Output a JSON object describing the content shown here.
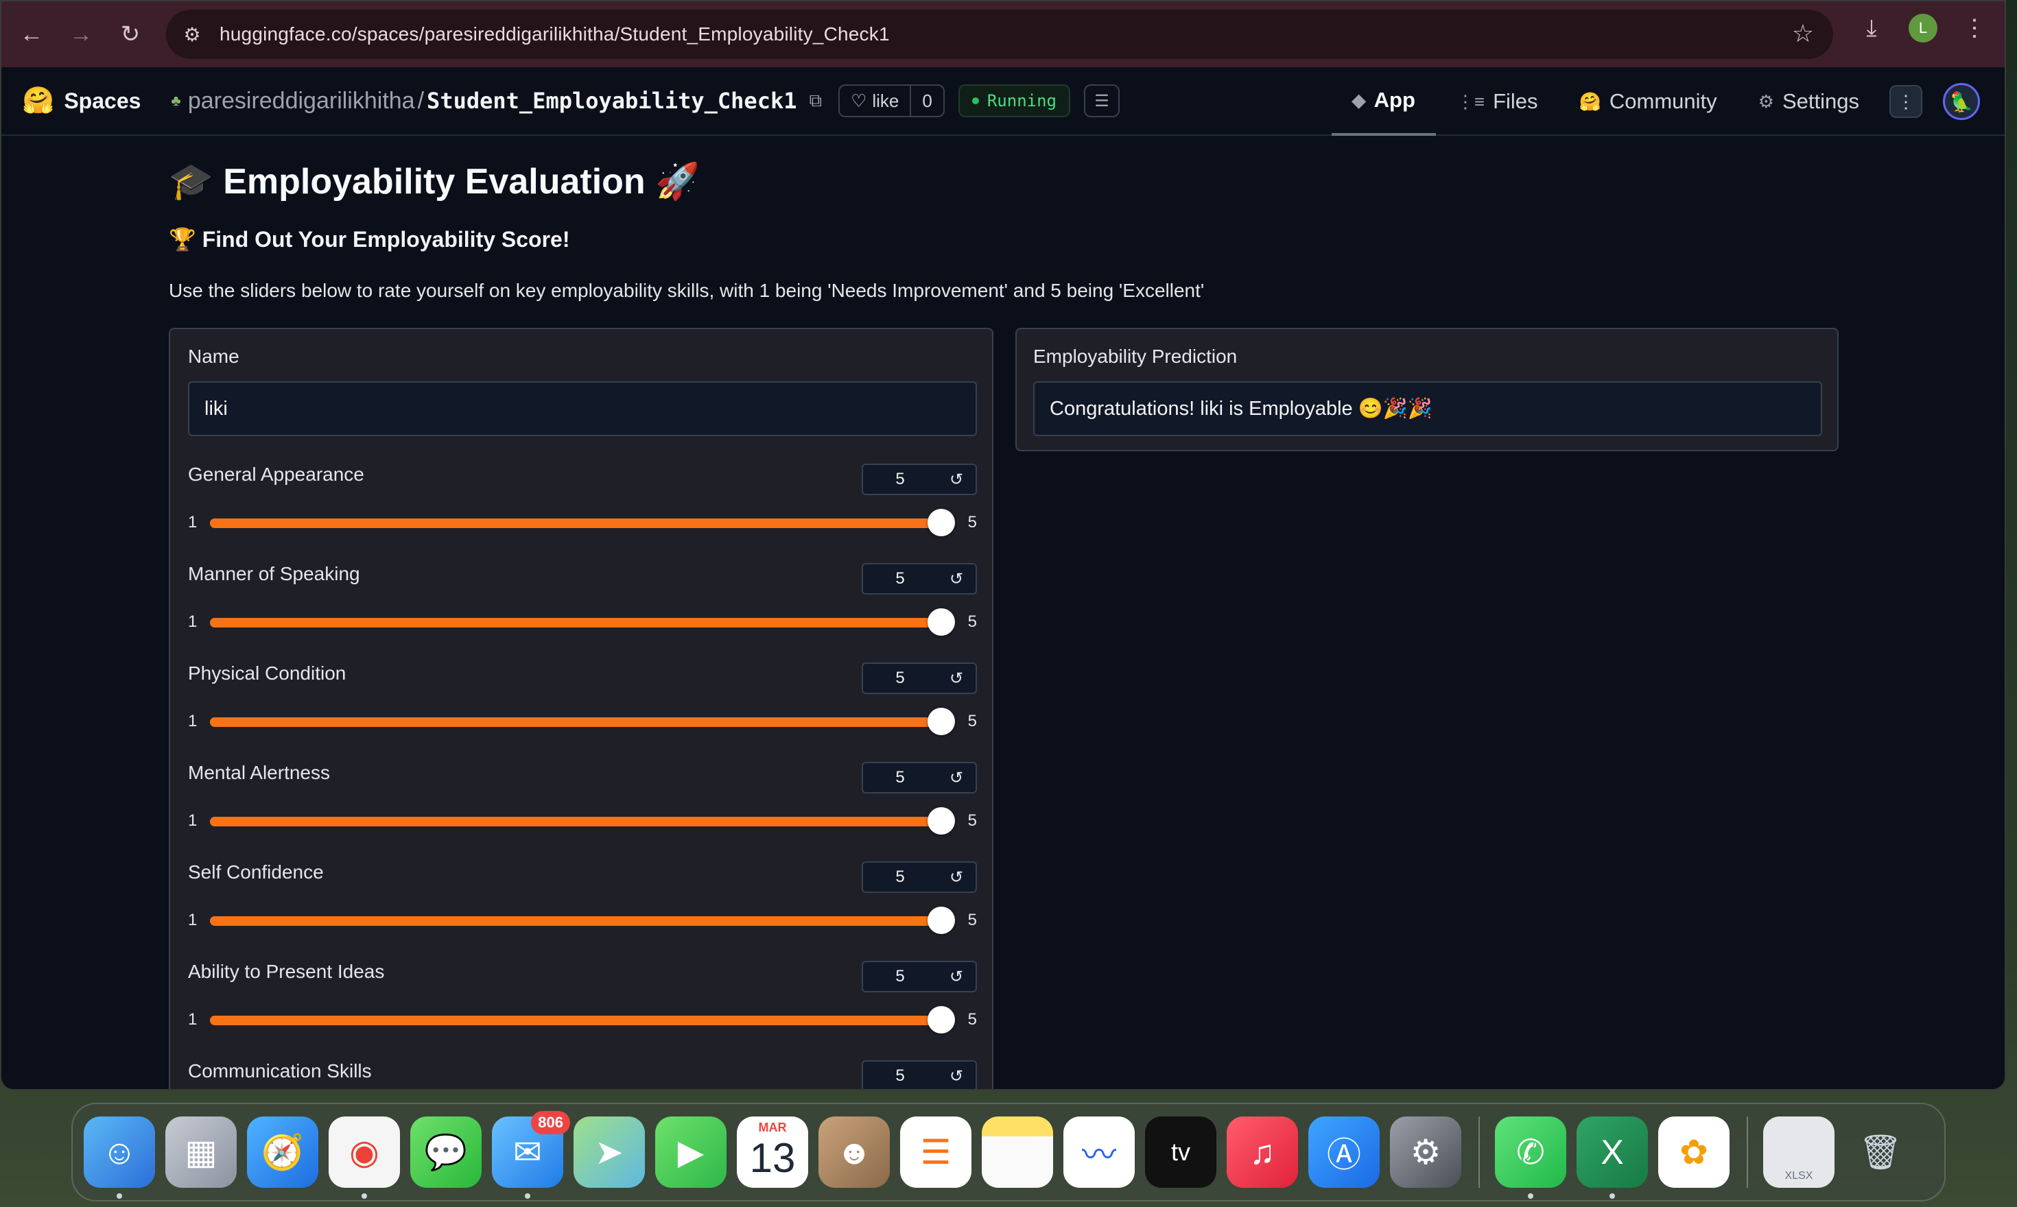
{
  "browser": {
    "url": "huggingface.co/spaces/paresireddigarilikhitha/Student_Employability_Check1",
    "profile_initial": "L"
  },
  "hf_header": {
    "spaces_label": "Spaces",
    "owner": "paresireddigarilikhitha",
    "separator": "/",
    "repo": "Student_Employability_Check1",
    "like_label": "like",
    "like_count": "0",
    "status": "Running",
    "tabs": [
      {
        "label": "App",
        "icon": "cube-icon"
      },
      {
        "label": "Files",
        "icon": "files-icon"
      },
      {
        "label": "Community",
        "icon": "community-icon"
      },
      {
        "label": "Settings",
        "icon": "gear-icon"
      }
    ]
  },
  "app": {
    "title": "🎓 Employability Evaluation 🚀",
    "subtitle": "🏆 Find Out Your Employability Score!",
    "description": "Use the sliders below to rate yourself on key employability skills, with 1 being 'Needs Improvement' and 5 being 'Excellent'",
    "name_field": {
      "label": "Name",
      "value": "liki"
    },
    "sliders": [
      {
        "label": "General Appearance",
        "value": "5",
        "min": "1",
        "max": "5",
        "fraction": 1.0
      },
      {
        "label": "Manner of Speaking",
        "value": "5",
        "min": "1",
        "max": "5",
        "fraction": 1.0
      },
      {
        "label": "Physical Condition",
        "value": "5",
        "min": "1",
        "max": "5",
        "fraction": 1.0
      },
      {
        "label": "Mental Alertness",
        "value": "5",
        "min": "1",
        "max": "5",
        "fraction": 1.0
      },
      {
        "label": "Self Confidence",
        "value": "5",
        "min": "1",
        "max": "5",
        "fraction": 1.0
      },
      {
        "label": "Ability to Present Ideas",
        "value": "5",
        "min": "1",
        "max": "5",
        "fraction": 1.0
      },
      {
        "label": "Communication Skills",
        "value": "5",
        "min": "1",
        "max": "5",
        "fraction": 1.0
      }
    ],
    "output": {
      "label": "Employability Prediction",
      "value": "Congratulations!  liki is Employable 😊🎉🎉"
    }
  },
  "dock": {
    "mail_badge": "806",
    "calendar_month": "MAR",
    "calendar_day": "13",
    "tv_label": "tv",
    "xlsx_label": "XLSX"
  },
  "colors": {
    "accent": "#f97316",
    "running": "#4ade80"
  }
}
